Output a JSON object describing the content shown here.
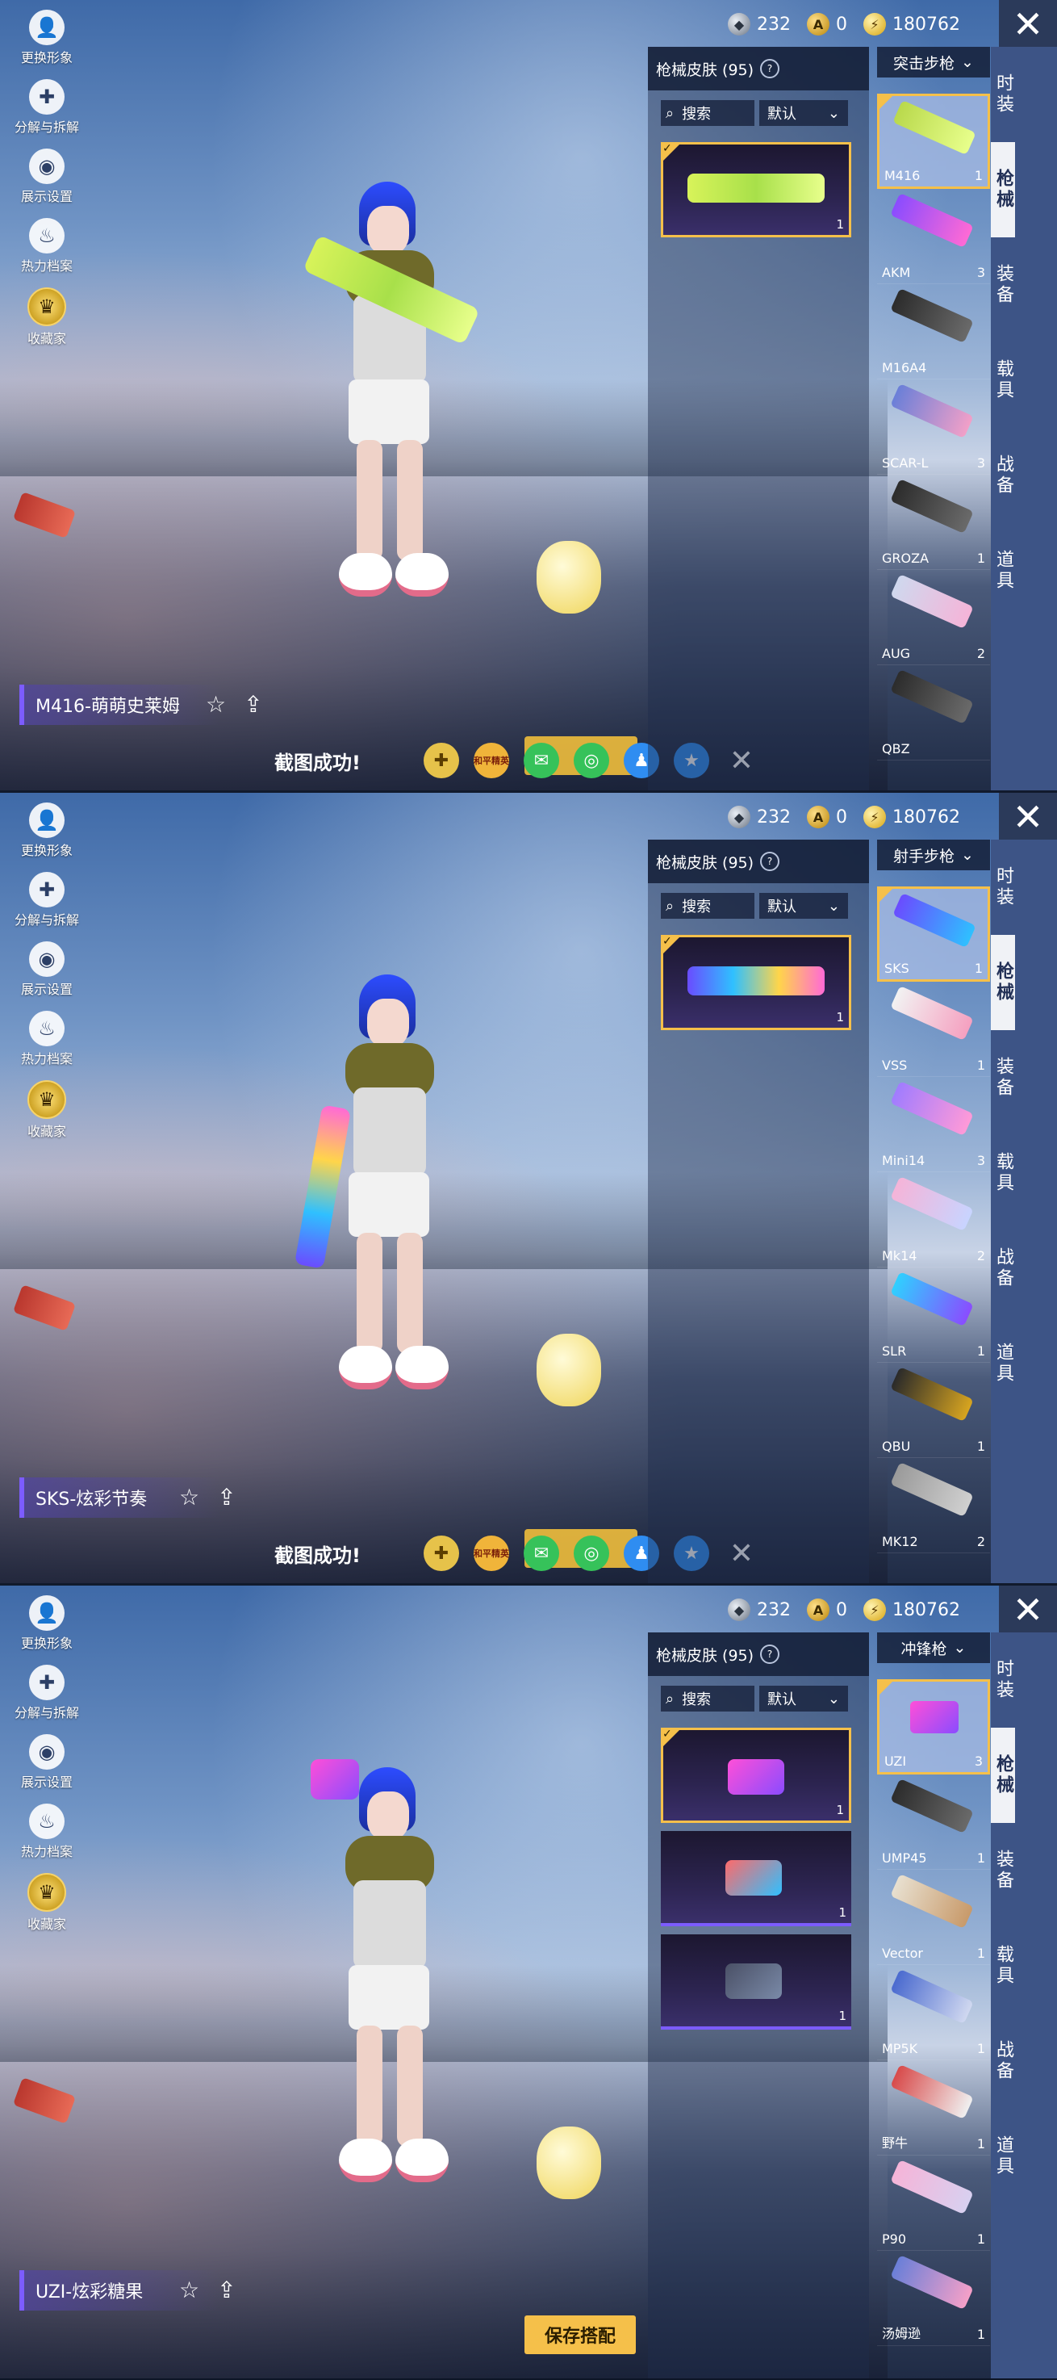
{
  "currencies": {
    "silver": "232",
    "gold": "0",
    "bolt": "180762"
  },
  "left_menu": [
    "更换形象",
    "分解与拆解",
    "展示设置",
    "热力档案",
    "收藏家"
  ],
  "tabs": [
    "时装",
    "枪械",
    "装备",
    "载具",
    "战备",
    "道具"
  ],
  "skin_panel": {
    "title": "枪械皮肤 (95)",
    "search": "搜索",
    "sort": "默认"
  },
  "share": {
    "message": "截图成功!",
    "logo_text": "和平精英"
  },
  "save_button": "保存搭配",
  "icons": {
    "close": "close-icon",
    "help": "help-icon",
    "search": "search-icon",
    "favorite": "star-icon",
    "share": "share-icon",
    "dropdown": "chevron-down-icon"
  },
  "colors": {
    "accent": "#f5c04a",
    "tab_bg": "#3d5486",
    "purple": "#7c5cff"
  },
  "panels": [
    {
      "skin_name": "M416-萌萌史莱姆",
      "category": "突击步枪",
      "skins": [
        {
          "count": "1",
          "selected": true
        }
      ],
      "weapons": [
        {
          "name": "M416",
          "num": "1"
        },
        {
          "name": "AKM",
          "num": "3"
        },
        {
          "name": "M16A4",
          "num": ""
        },
        {
          "name": "SCAR-L",
          "num": "3"
        },
        {
          "name": "GROZA",
          "num": "1"
        },
        {
          "name": "AUG",
          "num": "2"
        },
        {
          "name": "QBZ",
          "num": ""
        }
      ]
    },
    {
      "skin_name": "SKS-炫彩节奏",
      "category": "射手步枪",
      "skins": [
        {
          "count": "1",
          "selected": true
        }
      ],
      "weapons": [
        {
          "name": "SKS",
          "num": "1"
        },
        {
          "name": "VSS",
          "num": "1"
        },
        {
          "name": "Mini14",
          "num": "3"
        },
        {
          "name": "Mk14",
          "num": "2"
        },
        {
          "name": "SLR",
          "num": "1"
        },
        {
          "name": "QBU",
          "num": "1"
        },
        {
          "name": "MK12",
          "num": "2"
        }
      ]
    },
    {
      "skin_name": "UZI-炫彩糖果",
      "category": "冲锋枪",
      "skins": [
        {
          "count": "1",
          "selected": true
        },
        {
          "count": "1",
          "selected": false
        },
        {
          "count": "1",
          "selected": false
        }
      ],
      "weapons": [
        {
          "name": "UZI",
          "num": "3"
        },
        {
          "name": "UMP45",
          "num": "1"
        },
        {
          "name": "Vector",
          "num": "1"
        },
        {
          "name": "MP5K",
          "num": "1"
        },
        {
          "name": "野牛",
          "num": "1"
        },
        {
          "name": "P90",
          "num": "1"
        },
        {
          "name": "汤姆逊",
          "num": "1"
        }
      ]
    }
  ]
}
